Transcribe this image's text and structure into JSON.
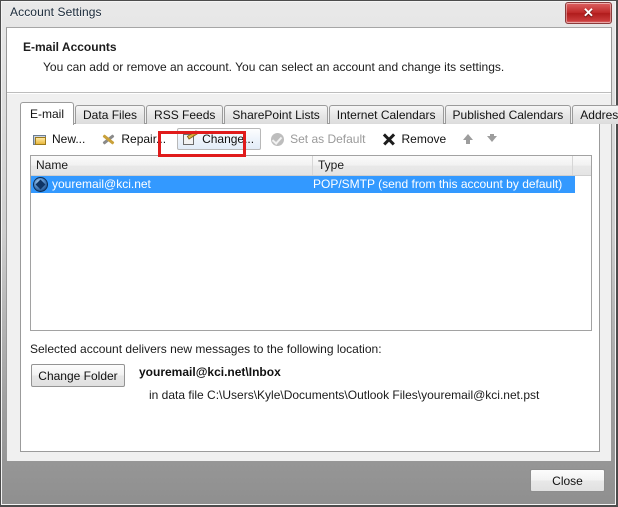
{
  "window": {
    "title": "Account Settings",
    "close_icon": "close-icon",
    "close_glyph": "✕"
  },
  "header": {
    "title": "E-mail Accounts",
    "subtitle": "You can add or remove an account. You can select an account and change its settings."
  },
  "tabs": [
    {
      "label": "E-mail",
      "active": true
    },
    {
      "label": "Data Files",
      "active": false
    },
    {
      "label": "RSS Feeds",
      "active": false
    },
    {
      "label": "SharePoint Lists",
      "active": false
    },
    {
      "label": "Internet Calendars",
      "active": false
    },
    {
      "label": "Published Calendars",
      "active": false
    },
    {
      "label": "Address Books",
      "active": false
    }
  ],
  "toolbar": {
    "new_label": "New...",
    "repair_label": "Repair...",
    "change_label": "Change...",
    "set_default_label": "Set as Default",
    "remove_label": "Remove",
    "move_up_label": "Move Up",
    "move_down_label": "Move Down",
    "highlight_color": "#e01b1b"
  },
  "list": {
    "columns": [
      "Name",
      "Type"
    ],
    "rows": [
      {
        "name": "youremail@kci.net",
        "type": "POP/SMTP (send from this account by default)",
        "is_default": true,
        "selected": true
      }
    ],
    "selection_color": "#3399ff"
  },
  "detail": {
    "label": "Selected account delivers new messages to the following location:",
    "change_folder_label": "Change Folder",
    "folder_path": "youremail@kci.net\\Inbox",
    "data_file_text": "in data file C:\\Users\\Kyle\\Documents\\Outlook Files\\youremail@kci.net.pst"
  },
  "footer": {
    "close_label": "Close"
  }
}
